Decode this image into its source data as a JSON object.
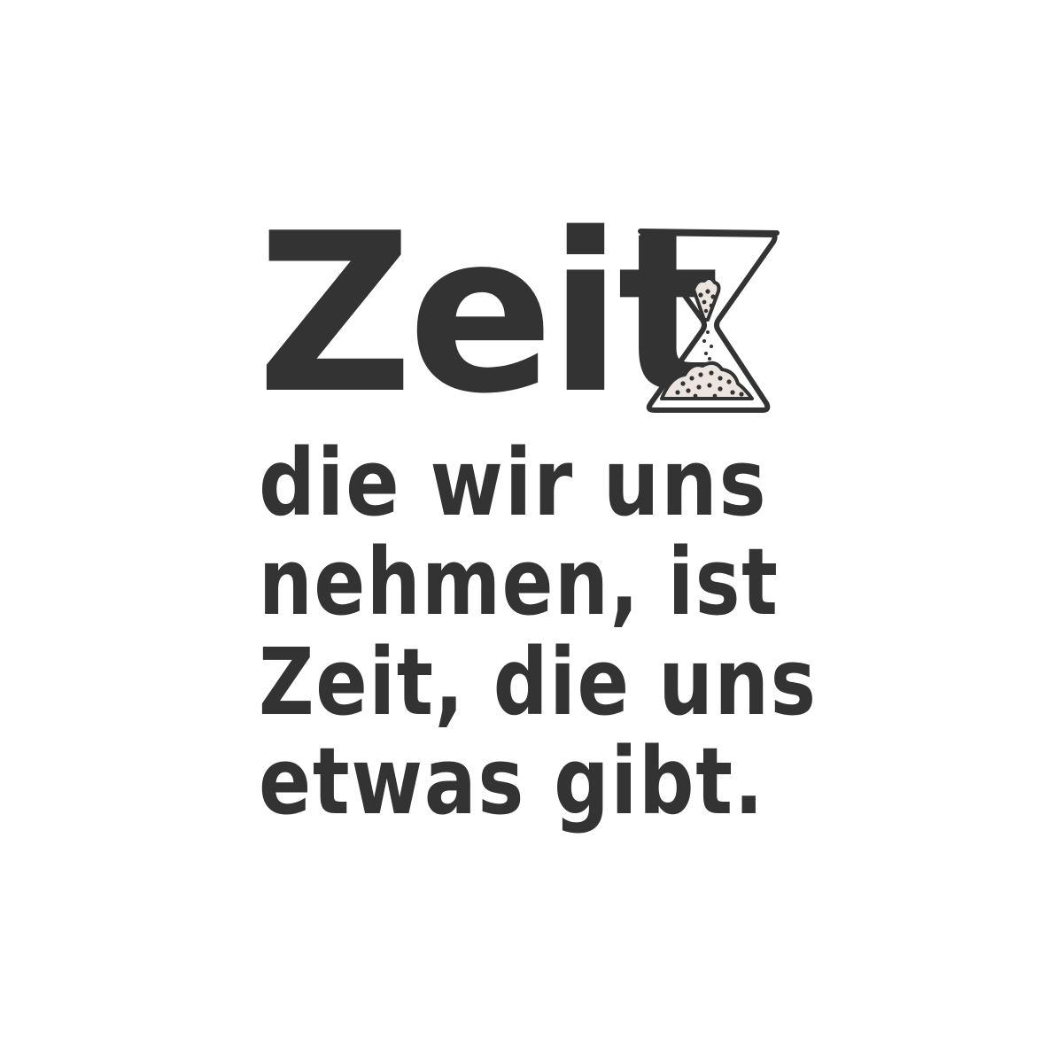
{
  "colors": {
    "background": "#ffffff",
    "ink": "#333333",
    "sand": "#ece4df"
  },
  "icon": "hourglass-icon",
  "quote": {
    "headline": "Zeit",
    "lines": [
      "die wir uns",
      "nehmen, ist",
      "Zeit, die uns",
      "etwas gibt."
    ]
  }
}
